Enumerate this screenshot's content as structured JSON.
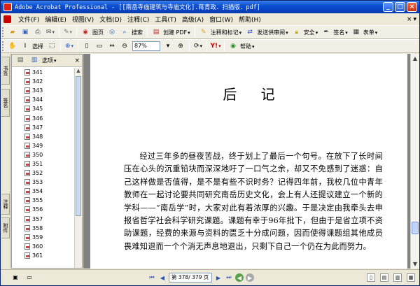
{
  "window": {
    "title": "Adobe Acrobat Professional - [[南岳寺庙建筑与寺庙文化].蒋青政．扫描版．pdf]",
    "controls": {
      "minimize": "_",
      "maximize": "□",
      "close": "×"
    }
  },
  "menubar": {
    "items": [
      "文件(F)",
      "编辑(E)",
      "视图(V)",
      "文档(D)",
      "注释(C)",
      "工具(T)",
      "高级(A)",
      "窗口(W)",
      "帮助(H)"
    ],
    "help_toggle": "×"
  },
  "toolbar1": {
    "print_label": "图页",
    "search_label": "搜索",
    "create_pdf_label": "创建 PDF",
    "review_label": "注释和标记",
    "send_review_label": "发送供审阅",
    "secure_label": "安全",
    "sign_label": "签名",
    "forms_label": "表单"
  },
  "toolbar2": {
    "select_label": "选择",
    "zoom_value": "87%",
    "help_label": "帮助"
  },
  "nav_tabs": [
    "书签",
    "签名",
    "注释",
    "附件"
  ],
  "bookmarks_panel": {
    "options_label": "选项",
    "close": "×",
    "items": [
      "341",
      "342",
      "343",
      "344",
      "345",
      "346",
      "347",
      "348",
      "349",
      "350",
      "351",
      "352",
      "353",
      "354",
      "355",
      "356",
      "357",
      "358",
      "359",
      "360",
      "361"
    ]
  },
  "document": {
    "heading": "后 记",
    "paragraph": "经过三年多的昼夜苦战，终于划上了最后一个句号。在放下了长时间压在心头的沉重铅块而深深地吁了一口气之余，却又不免感到了迷惑：自己这样做是否值得，是不是有些不识时务？记得四年前，我校几位中青年教师在一起讨论要共同研究南岳历史文化，会上有人还提议建立一个新的学科——“南岳学”时，大家对此有着浓厚的兴趣。于是决定由我牵头去申报省哲学社会科学研究课题。课题有幸于96年批下，但由于是省立项不资助课题，经费的来源与资料的匮乏十分成问题，因而使得课题组其他成员畏难知退而一个个消无声息地退出，只剩下自己一个仍在为此而努力。"
  },
  "statusbar": {
    "page_display": "第 378/ 379 页"
  }
}
